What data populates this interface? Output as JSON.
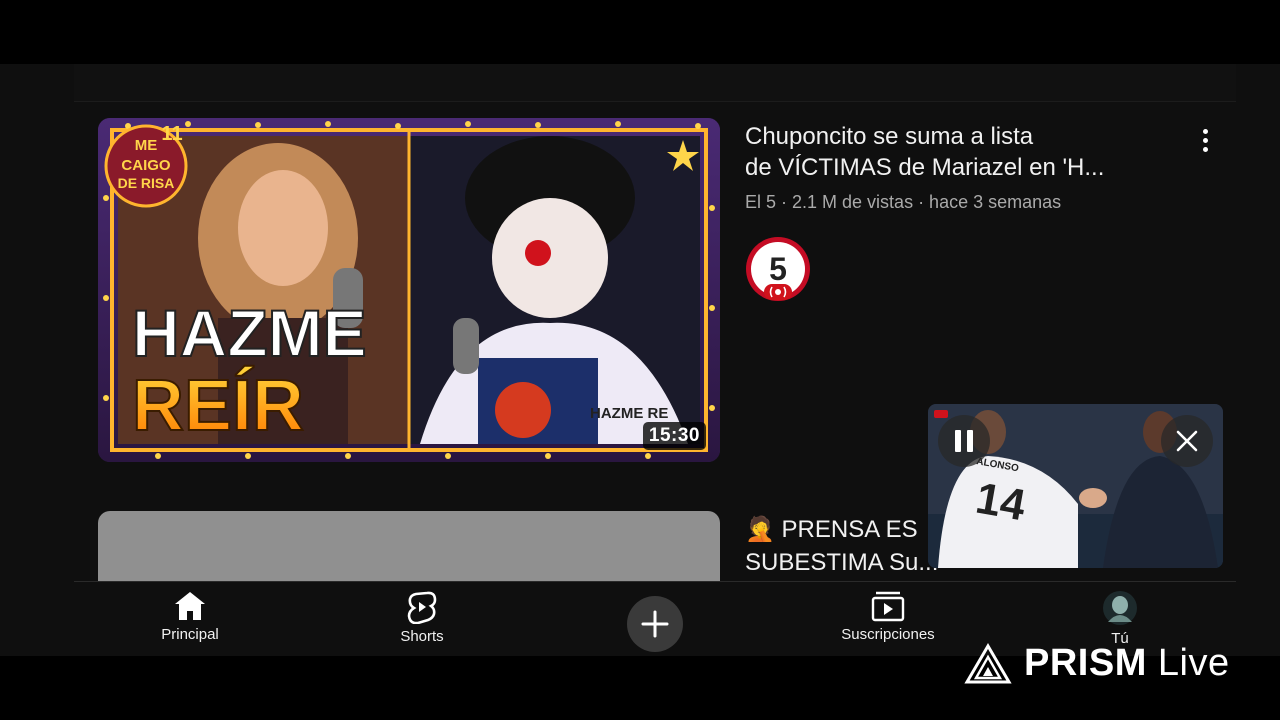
{
  "feed": {
    "video1": {
      "title_line1": "Chuponcito se suma a lista",
      "title_line2": "de VÍCTIMAS de Mariazel en 'H...",
      "meta": "El 5 · 2.1 M de vistas · hace 3 semanas",
      "duration": "15:30",
      "thumb_show_logo_line1": "ME",
      "thumb_show_logo_number": "11",
      "thumb_show_logo_line2": "CAIGO",
      "thumb_show_logo_line3": "DE RISA",
      "thumb_text_line1": "HAZME",
      "thumb_text_line2": "REÍR",
      "thumb_shirt_text": "HAZME RE",
      "channel_avatar_text": "5"
    },
    "video2": {
      "title_line1": "🤦 PRENSA ES",
      "title_line2": "SUBESTIMA Su..."
    }
  },
  "miniplayer": {
    "jersey_name": "ALONSO",
    "jersey_number": "14"
  },
  "nav": {
    "home": "Principal",
    "shorts": "Shorts",
    "subscriptions": "Suscripciones",
    "you": "Tú"
  },
  "watermark": {
    "brand_bold": "PRISM",
    "brand_light": "Live"
  },
  "colors": {
    "background": "#0f0f0f",
    "accent_red": "#cc0000",
    "thumb_orange": "#ff8a00",
    "thumb_purple": "#5b2a8c"
  }
}
